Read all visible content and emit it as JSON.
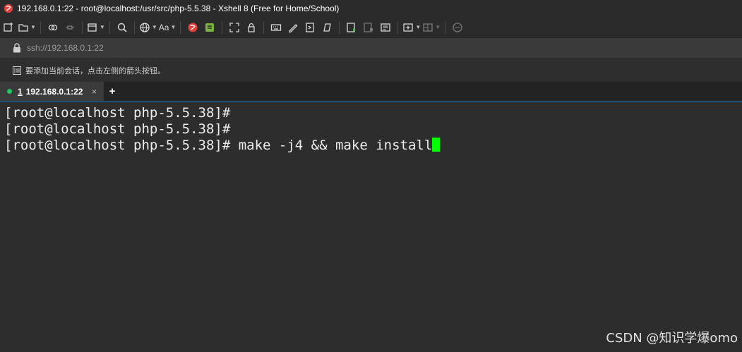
{
  "window": {
    "title": "192.168.0.1:22 - root@localhost:/usr/src/php-5.5.38 - Xshell 8 (Free for Home/School)",
    "app_icon": "xshell-logo-icon",
    "accent": "#e0403c"
  },
  "toolbar": {
    "buttons": [
      "new-session-icon",
      "open-folder-icon",
      "reconnect-icon",
      "disconnect-icon",
      "new-window-icon",
      "search-icon",
      "globe-icon",
      "font-icon",
      "xshell-icon",
      "xftp-icon",
      "fullscreen-icon",
      "lock-icon",
      "keyboard-icon",
      "compose-icon",
      "script-icon",
      "sftp-icon",
      "start-recording-icon",
      "stop-recording-icon",
      "log-icon",
      "new-tab-icon",
      "layout-icon",
      "chat-icon"
    ],
    "font_label": "Aa"
  },
  "address": {
    "url": "ssh://192.168.0.1:22"
  },
  "hint": {
    "text": "要添加当前会话，点击左侧的箭头按钮。"
  },
  "tabs": [
    {
      "number": "1",
      "label": "192.168.0.1:22",
      "status_color": "#22c55e",
      "close": "×"
    }
  ],
  "tab_add": "+",
  "terminal": {
    "lines": [
      "[root@localhost php-5.5.38]#",
      "[root@localhost php-5.5.38]#",
      "[root@localhost php-5.5.38]# make -j4 && make install"
    ],
    "cursor_color": "#00ff00"
  },
  "watermark": "CSDN @知识学爆omo"
}
